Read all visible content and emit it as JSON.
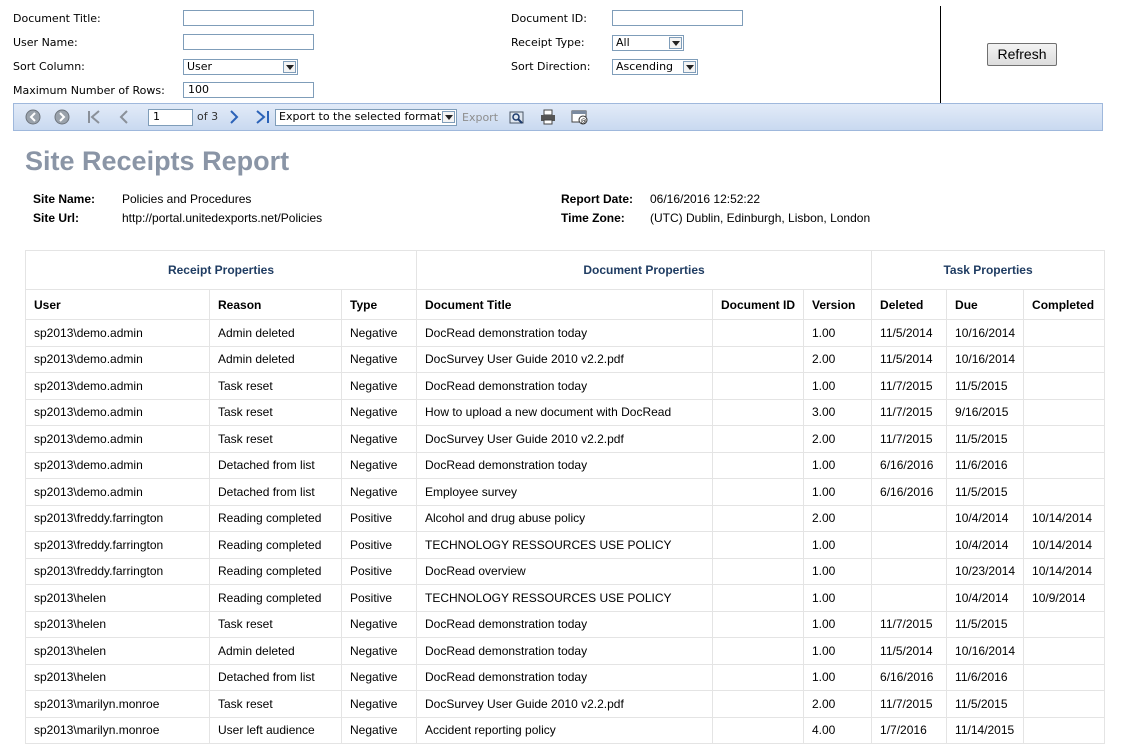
{
  "params": {
    "document_title_label": "Document Title:",
    "document_title_value": "",
    "document_id_label": "Document ID:",
    "document_id_value": "",
    "user_name_label": "User Name:",
    "user_name_value": "",
    "receipt_type_label": "Receipt Type:",
    "receipt_type_value": "All",
    "sort_column_label": "Sort Column:",
    "sort_column_value": "User",
    "sort_direction_label": "Sort Direction:",
    "sort_direction_value": "Ascending",
    "max_rows_label": "Maximum Number of Rows:",
    "max_rows_value": "100",
    "refresh_label": "Refresh"
  },
  "toolbar": {
    "page_value": "1",
    "page_of": "of 3",
    "export_format": "Export to the selected format",
    "export_label": "Export"
  },
  "report": {
    "title": "Site Receipts Report",
    "site_name_label": "Site Name:",
    "site_name": "Policies and Procedures",
    "site_url_label": "Site Url:",
    "site_url": "http://portal.unitedexports.net/Policies",
    "report_date_label": "Report Date:",
    "report_date": "06/16/2016 12:52:22",
    "time_zone_label": "Time Zone:",
    "time_zone": "(UTC) Dublin, Edinburgh, Lisbon, London"
  },
  "table": {
    "groups": [
      "Receipt Properties",
      "Document Properties",
      "Task Properties"
    ],
    "columns": [
      "User",
      "Reason",
      "Type",
      "Document Title",
      "Document ID",
      "Version",
      "Deleted",
      "Due",
      "Completed"
    ],
    "rows": [
      [
        "sp2013\\demo.admin",
        "Admin deleted",
        "Negative",
        "DocRead demonstration today",
        "",
        "1.00",
        "11/5/2014",
        "10/16/2014",
        ""
      ],
      [
        "sp2013\\demo.admin",
        "Admin deleted",
        "Negative",
        "DocSurvey User Guide 2010 v2.2.pdf",
        "",
        "2.00",
        "11/5/2014",
        "10/16/2014",
        ""
      ],
      [
        "sp2013\\demo.admin",
        "Task reset",
        "Negative",
        "DocRead demonstration today",
        "",
        "1.00",
        "11/7/2015",
        "11/5/2015",
        ""
      ],
      [
        "sp2013\\demo.admin",
        "Task reset",
        "Negative",
        "How to upload a new document with DocRead",
        "",
        "3.00",
        "11/7/2015",
        "9/16/2015",
        ""
      ],
      [
        "sp2013\\demo.admin",
        "Task reset",
        "Negative",
        "DocSurvey User Guide 2010 v2.2.pdf",
        "",
        "2.00",
        "11/7/2015",
        "11/5/2015",
        ""
      ],
      [
        "sp2013\\demo.admin",
        "Detached from list",
        "Negative",
        "DocRead demonstration today",
        "",
        "1.00",
        "6/16/2016",
        "11/6/2016",
        ""
      ],
      [
        "sp2013\\demo.admin",
        "Detached from list",
        "Negative",
        "Employee survey",
        "",
        "1.00",
        "6/16/2016",
        "11/5/2015",
        ""
      ],
      [
        "sp2013\\freddy.farrington",
        "Reading completed",
        "Positive",
        "Alcohol and drug abuse policy",
        "",
        "2.00",
        "",
        "10/4/2014",
        "10/14/2014"
      ],
      [
        "sp2013\\freddy.farrington",
        "Reading completed",
        "Positive",
        "TECHNOLOGY RESSOURCES USE POLICY",
        "",
        "1.00",
        "",
        "10/4/2014",
        "10/14/2014"
      ],
      [
        "sp2013\\freddy.farrington",
        "Reading completed",
        "Positive",
        "DocRead overview",
        "",
        "1.00",
        "",
        "10/23/2014",
        "10/14/2014"
      ],
      [
        "sp2013\\helen",
        "Reading completed",
        "Positive",
        "TECHNOLOGY RESSOURCES USE POLICY",
        "",
        "1.00",
        "",
        "10/4/2014",
        "10/9/2014"
      ],
      [
        "sp2013\\helen",
        "Task reset",
        "Negative",
        "DocRead demonstration today",
        "",
        "1.00",
        "11/7/2015",
        "11/5/2015",
        ""
      ],
      [
        "sp2013\\helen",
        "Admin deleted",
        "Negative",
        "DocRead demonstration today",
        "",
        "1.00",
        "11/5/2014",
        "10/16/2014",
        ""
      ],
      [
        "sp2013\\helen",
        "Detached from list",
        "Negative",
        "DocRead demonstration today",
        "",
        "1.00",
        "6/16/2016",
        "11/6/2016",
        ""
      ],
      [
        "sp2013\\marilyn.monroe",
        "Task reset",
        "Negative",
        "DocSurvey User Guide 2010 v2.2.pdf",
        "",
        "2.00",
        "11/7/2015",
        "11/5/2015",
        ""
      ],
      [
        "sp2013\\marilyn.monroe",
        "User left audience",
        "Negative",
        "Accident reporting policy",
        "",
        "4.00",
        "1/7/2016",
        "11/14/2015",
        ""
      ]
    ]
  }
}
